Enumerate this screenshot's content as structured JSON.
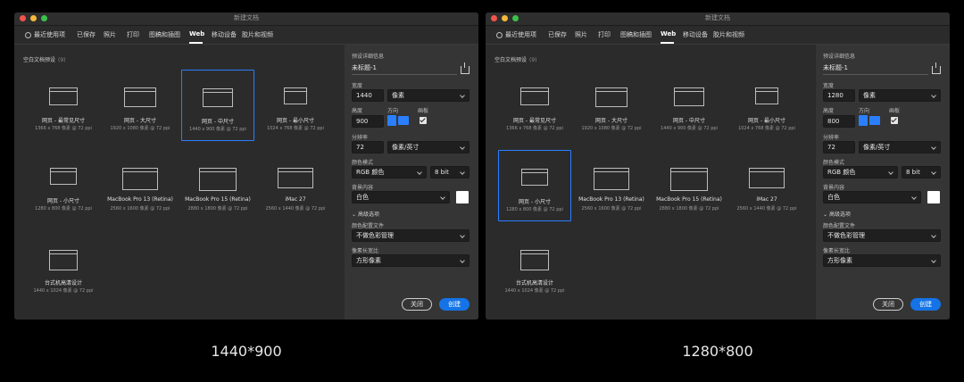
{
  "windows": [
    {
      "title": "新建文档",
      "tabs": [
        {
          "label": "最近使用项",
          "active": false
        },
        {
          "label": "已保存",
          "active": false
        },
        {
          "label": "照片",
          "active": false
        },
        {
          "label": "打印",
          "active": false
        },
        {
          "label": "图稿和插图",
          "active": false
        },
        {
          "label": "Web",
          "active": true
        },
        {
          "label": "移动设备",
          "active": false
        },
        {
          "label": "胶片和视频",
          "active": false
        }
      ],
      "section": {
        "title": "空白文档预设",
        "count": "(9)"
      },
      "presets": [
        {
          "name": "网页 - 最常见尺寸",
          "dims": "1366 x 768 像素 @ 72 ppi"
        },
        {
          "name": "网页 - 大尺寸",
          "dims": "1920 x 1080 像素 @ 72 ppi"
        },
        {
          "name": "网页 - 中尺寸",
          "dims": "1440 x 900 像素 @ 72 ppi"
        },
        {
          "name": "网页 - 最小尺寸",
          "dims": "1024 x 768 像素 @ 72 ppi"
        },
        {
          "name": "网页 - 小尺寸",
          "dims": "1280 x 800 像素 @ 72 ppi"
        },
        {
          "name": "MacBook Pro 13 (Retina)",
          "dims": "2560 x 1600 像素 @ 72 ppi"
        },
        {
          "name": "MacBook Pro 15 (Retina)",
          "dims": "2880 x 1800 像素 @ 72 ppi"
        },
        {
          "name": "iMac 27",
          "dims": "2560 x 1440 像素 @ 72 ppi"
        },
        {
          "name": "台式机高清设计",
          "dims": "1440 x 1024 像素 @ 72 ppi"
        }
      ],
      "selected_preset": "网页 - 中尺寸",
      "details": {
        "header": "预设详细信息",
        "doc_name": "未标题-1",
        "width_label": "宽度",
        "width": "1440",
        "width_unit": "像素",
        "height_label": "高度",
        "height": "900",
        "orientation_label": "方向",
        "artboard_label": "画板",
        "resolution_label": "分辨率",
        "resolution": "72",
        "resolution_unit": "像素/英寸",
        "color_mode_label": "颜色模式",
        "color_mode": "RGB 颜色",
        "bit_depth": "8 bit",
        "background_label": "背景内容",
        "background": "白色",
        "advanced": "高级选项",
        "profile_label": "颜色配置文件",
        "profile": "不做色彩管理",
        "pixel_aspect_label": "像素长宽比",
        "pixel_aspect": "方形像素",
        "close_button": "关闭",
        "create_button": "创建"
      }
    },
    {
      "title": "新建文档",
      "tabs": [
        {
          "label": "最近使用项",
          "active": false
        },
        {
          "label": "已保存",
          "active": false
        },
        {
          "label": "照片",
          "active": false
        },
        {
          "label": "打印",
          "active": false
        },
        {
          "label": "图稿和插图",
          "active": false
        },
        {
          "label": "Web",
          "active": true
        },
        {
          "label": "移动设备",
          "active": false
        },
        {
          "label": "胶片和视频",
          "active": false
        }
      ],
      "section": {
        "title": "空白文档预设",
        "count": "(9)"
      },
      "presets": [
        {
          "name": "网页 - 最常见尺寸",
          "dims": "1366 x 768 像素 @ 72 ppi"
        },
        {
          "name": "网页 - 大尺寸",
          "dims": "1920 x 1080 像素 @ 72 ppi"
        },
        {
          "name": "网页 - 中尺寸",
          "dims": "1440 x 900 像素 @ 72 ppi"
        },
        {
          "name": "网页 - 最小尺寸",
          "dims": "1024 x 768 像素 @ 72 ppi"
        },
        {
          "name": "网页 - 小尺寸",
          "dims": "1280 x 800 像素 @ 72 ppi"
        },
        {
          "name": "MacBook Pro 13 (Retina)",
          "dims": "2560 x 1600 像素 @ 72 ppi"
        },
        {
          "name": "MacBook Pro 15 (Retina)",
          "dims": "2880 x 1800 像素 @ 72 ppi"
        },
        {
          "name": "iMac 27",
          "dims": "2560 x 1440 像素 @ 72 ppi"
        },
        {
          "name": "台式机高清设计",
          "dims": "1440 x 1024 像素 @ 72 ppi"
        }
      ],
      "selected_preset": "网页 - 小尺寸",
      "details": {
        "header": "预设详细信息",
        "doc_name": "未标题-1",
        "width_label": "宽度",
        "width": "1280",
        "width_unit": "像素",
        "height_label": "高度",
        "height": "800",
        "orientation_label": "方向",
        "artboard_label": "画板",
        "resolution_label": "分辨率",
        "resolution": "72",
        "resolution_unit": "像素/英寸",
        "color_mode_label": "颜色模式",
        "color_mode": "RGB 颜色",
        "bit_depth": "8 bit",
        "background_label": "背景内容",
        "background": "白色",
        "advanced": "高级选项",
        "profile_label": "颜色配置文件",
        "profile": "不做色彩管理",
        "pixel_aspect_label": "像素长宽比",
        "pixel_aspect": "方形像素",
        "close_button": "关闭",
        "create_button": "创建"
      }
    }
  ],
  "captions": [
    "1440*900",
    "1280*800"
  ],
  "colors": {
    "accent": "#2a7fff",
    "create_button": "#1473e6",
    "window_bg": "#2b2b2b",
    "panel_bg": "#353535"
  },
  "icons": [
    "clock-icon",
    "save-to-cloud-icon",
    "portrait-orientation-icon",
    "landscape-orientation-icon",
    "checkbox-checked-icon",
    "chevron-down-icon",
    "document-preset-icon"
  ]
}
